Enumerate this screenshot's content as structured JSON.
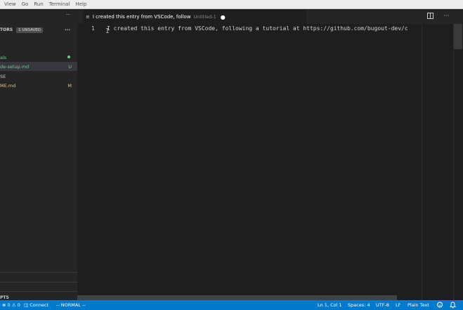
{
  "menubar": {
    "items": [
      "View",
      "Go",
      "Run",
      "Terminal",
      "Help"
    ]
  },
  "sidebar": {
    "top_label": "",
    "more": "···",
    "open_editors": {
      "label": "TORS",
      "badge": "1 UNSAVED",
      "more": "···"
    },
    "git_item": {
      "label": "als"
    },
    "files": [
      {
        "label": "de-setup.md",
        "status": "U"
      },
      {
        "label": "SE",
        "status": ""
      },
      {
        "label": "ME.md",
        "status": "M"
      }
    ],
    "outline_label": "PTS",
    "bottom_label": "S"
  },
  "tab": {
    "icon": "≡",
    "title": "I created this entry from VSCode, follow",
    "description": "Untitled-1",
    "dirty": "●"
  },
  "editor": {
    "line_number": "1",
    "text": "I created this entry from VSCode, following a tutorial at https://github.com/bugout-dev/c",
    "cursor": "I"
  },
  "statusbar": {
    "left": [
      "⊗ 0 ⚠ 0",
      "Connect",
      "-- NORMAL --"
    ],
    "right": [
      "Ln 1, Col 1",
      "Spaces: 4",
      "UTF-8",
      "LF",
      "Plain Text"
    ]
  },
  "colors": {
    "status_bar": "#007acc",
    "editor_bg": "#1e1e1e",
    "sidebar_bg": "#252526",
    "untracked": "#73c991",
    "modified": "#e2c08d"
  }
}
